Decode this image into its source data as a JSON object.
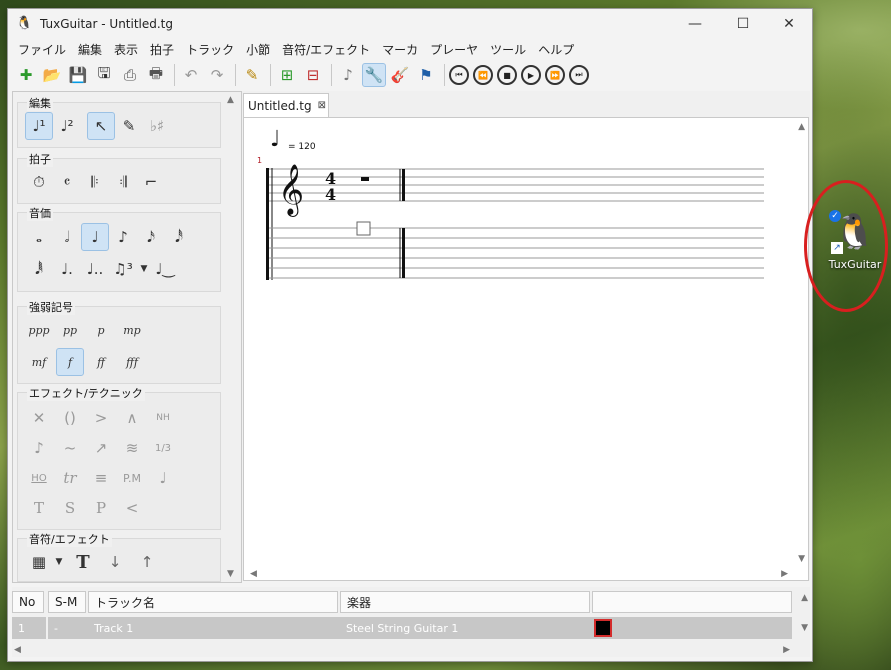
{
  "window": {
    "title": "TuxGuitar - Untitled.tg",
    "controls": [
      "—",
      "☐",
      "✕"
    ]
  },
  "menu": [
    "ファイル",
    "編集",
    "表示",
    "拍子",
    "トラック",
    "小節",
    "音符/エフェクト",
    "マーカ",
    "プレーヤ",
    "ツール",
    "ヘルプ"
  ],
  "toolbar": {
    "file_icons": [
      "new-file-icon",
      "open-file-icon",
      "save-icon",
      "save-as-icon",
      "print-icon",
      "print-preview-icon"
    ],
    "edit_icons": [
      "undo-icon",
      "redo-icon",
      "pencil-icon"
    ],
    "transport_icons": [
      "first-icon",
      "rewind-icon",
      "stop-icon",
      "play-icon",
      "fast-forward-icon",
      "last-icon"
    ]
  },
  "panel": {
    "edit_label": "編集",
    "beat_label": "拍子",
    "duration_label": "音価",
    "dynamics_label": "強弱記号",
    "dynamics": [
      "ppp",
      "pp",
      "p",
      "mp",
      "mf",
      "f",
      "ff",
      "fff"
    ],
    "effects_label": "エフェクト/テクニック",
    "effects_row1": [
      "✕",
      "()",
      ">",
      "∧",
      "NH"
    ],
    "effects_row2": [
      "♪",
      "~",
      "↗",
      "≋",
      "1/3"
    ],
    "effects_row3": [
      "HO",
      "tr",
      "≡",
      "P.M",
      "♩"
    ],
    "effects_row4": [
      "T",
      "S",
      "P",
      "<"
    ],
    "note_effects_label": "音符/エフェクト"
  },
  "tab": {
    "label": "Untitled.tg",
    "close": "⊠"
  },
  "score": {
    "tempo": "= 120",
    "measure_number": "1",
    "time_sig_top": "4",
    "time_sig_bottom": "4"
  },
  "tracks": {
    "headers": [
      "No",
      "S-M",
      "トラック名",
      "楽器"
    ],
    "rows": [
      {
        "no": "1",
        "sm": "-",
        "name": "Track 1",
        "instrument": "Steel String Guitar 1"
      }
    ]
  },
  "desktop": {
    "icon_label": "TuxGuitar"
  }
}
